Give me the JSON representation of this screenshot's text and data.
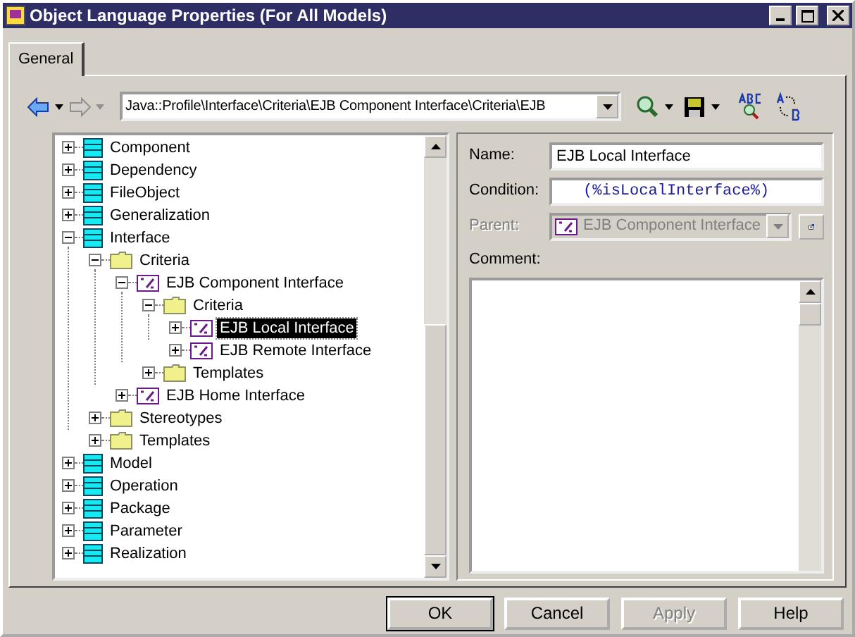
{
  "window": {
    "title": "Object Language Properties (For All Models)"
  },
  "tabs": [
    {
      "label": "General",
      "selected": true
    }
  ],
  "toolbar": {
    "path": "Java::Profile\\Interface\\Criteria\\EJB Component Interface\\Criteria\\EJB",
    "back_disabled": false,
    "forward_disabled": true
  },
  "tree": [
    {
      "label": "Component",
      "kind": "class",
      "expanded": false,
      "selected": false
    },
    {
      "label": "Dependency",
      "kind": "class",
      "expanded": false,
      "selected": false
    },
    {
      "label": "FileObject",
      "kind": "class",
      "expanded": false,
      "selected": false
    },
    {
      "label": "Generalization",
      "kind": "class",
      "expanded": false,
      "selected": false
    },
    {
      "label": "Interface",
      "kind": "class",
      "expanded": true,
      "selected": false,
      "children": [
        {
          "label": "Criteria",
          "kind": "folder",
          "expanded": true,
          "selected": false,
          "children": [
            {
              "label": "EJB Component Interface",
              "kind": "template",
              "expanded": true,
              "selected": false,
              "children": [
                {
                  "label": "Criteria",
                  "kind": "folder",
                  "expanded": true,
                  "selected": false,
                  "children": [
                    {
                      "label": "EJB Local Interface",
                      "kind": "template",
                      "expanded": false,
                      "selected": true
                    },
                    {
                      "label": "EJB Remote Interface",
                      "kind": "template",
                      "expanded": false,
                      "selected": false
                    }
                  ]
                },
                {
                  "label": "Templates",
                  "kind": "folder",
                  "expanded": false,
                  "selected": false
                }
              ]
            },
            {
              "label": "EJB Home Interface",
              "kind": "template",
              "expanded": false,
              "selected": false
            }
          ]
        },
        {
          "label": "Stereotypes",
          "kind": "folder",
          "expanded": false,
          "selected": false
        },
        {
          "label": "Templates",
          "kind": "folder",
          "expanded": false,
          "selected": false
        }
      ]
    },
    {
      "label": "Model",
      "kind": "class",
      "expanded": false,
      "selected": false
    },
    {
      "label": "Operation",
      "kind": "class",
      "expanded": false,
      "selected": false
    },
    {
      "label": "Package",
      "kind": "class",
      "expanded": false,
      "selected": false
    },
    {
      "label": "Parameter",
      "kind": "class",
      "expanded": false,
      "selected": false
    },
    {
      "label": "Realization",
      "kind": "class",
      "expanded": false,
      "selected": false
    }
  ],
  "properties": {
    "name": {
      "label": "Name:",
      "value": "EJB Local Interface"
    },
    "condition": {
      "label": "Condition:",
      "value": "(%isLocalInterface%)"
    },
    "parent": {
      "label": "Parent:",
      "value": "EJB Component Interface",
      "disabled": true
    },
    "comment": {
      "label": "Comment:"
    }
  },
  "buttons": [
    {
      "label": "OK",
      "default": true,
      "disabled": false
    },
    {
      "label": "Cancel",
      "default": false,
      "disabled": false
    },
    {
      "label": "Apply",
      "default": false,
      "disabled": true
    },
    {
      "label": "Help",
      "default": false,
      "disabled": false
    }
  ]
}
